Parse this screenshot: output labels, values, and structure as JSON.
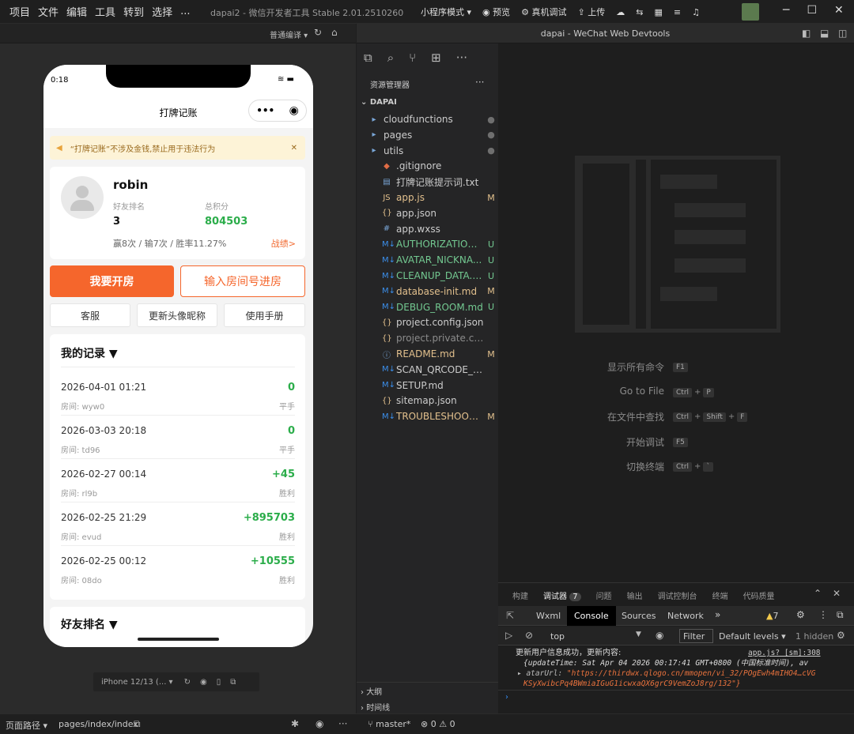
{
  "menu": [
    "项目",
    "文件",
    "编辑",
    "工具",
    "转到",
    "选择",
    "..."
  ],
  "app_title": "dapai2 - 微信开发者工具 Stable 2.01.2510260",
  "top_actions": {
    "mode": "小程序模式",
    "preview": "预览",
    "real": "真机调试",
    "upload": "上传"
  },
  "sim_toolbar": {
    "compile": "普通编译"
  },
  "window_title": "dapai - WeChat Web Devtools",
  "phone": {
    "time": "0:18",
    "page_title": "打牌记账",
    "notice": "“打牌记账”不涉及金钱,禁止用于违法行为",
    "user": {
      "name": "robin",
      "rank_label": "好友排名",
      "rank": "3",
      "score_label": "总积分",
      "score": "804503",
      "stats": "赢8次 / 输7次 / 胜率11.27%",
      "record_link": "战绩>"
    },
    "btn_open": "我要开房",
    "btn_join": "输入房间号进房",
    "btn_service": "客服",
    "btn_update": "更新头像昵称",
    "btn_manual": "使用手册",
    "records_title": "我的记录 ▼",
    "records": [
      {
        "date": "2026-04-01 01:21",
        "room": "房间: wyw0",
        "value": "0",
        "status": "平手"
      },
      {
        "date": "2026-03-03 20:18",
        "room": "房间: td96",
        "value": "0",
        "status": "平手"
      },
      {
        "date": "2026-02-27 00:14",
        "room": "房间: rl9b",
        "value": "+45",
        "status": "胜利"
      },
      {
        "date": "2026-02-25 21:29",
        "room": "房间: evud",
        "value": "+895703",
        "status": "胜利"
      },
      {
        "date": "2026-02-25 00:12",
        "room": "房间: 08do",
        "value": "+10555",
        "status": "胜利"
      }
    ],
    "friends_title": "好友排名 ▼"
  },
  "device": "iPhone 12/13 (...",
  "explorer": {
    "title": "资源管理器",
    "root": "DAPAI",
    "items": [
      {
        "name": "cloudfunctions",
        "icon": "▸",
        "status": "●",
        "color": "#cccccc",
        "scolor": "#6f6f6f"
      },
      {
        "name": "pages",
        "icon": "▸",
        "status": "●",
        "color": "#cccccc",
        "scolor": "#6f6f6f"
      },
      {
        "name": "utils",
        "icon": "▸",
        "status": "●",
        "color": "#cccccc",
        "scolor": "#6f6f6f"
      },
      {
        "name": ".gitignore",
        "icon": "◆",
        "status": "",
        "color": "#cccccc",
        "scolor": "#cccccc"
      },
      {
        "name": "打牌记账提示词.txt",
        "icon": "▤",
        "status": "",
        "color": "#cccccc",
        "scolor": "#cccccc"
      },
      {
        "name": "app.js",
        "icon": "JS",
        "status": "M",
        "color": "#e2c08d",
        "scolor": "#e2c08d"
      },
      {
        "name": "app.json",
        "icon": "{}",
        "status": "",
        "color": "#cccccc",
        "scolor": "#cccccc"
      },
      {
        "name": "app.wxss",
        "icon": "#",
        "status": "",
        "color": "#cccccc",
        "scolor": "#cccccc"
      },
      {
        "name": "AUTHORIZATION_...",
        "icon": "M↓",
        "status": "U",
        "color": "#73c991",
        "scolor": "#73c991"
      },
      {
        "name": "AVATAR_NICKNA...",
        "icon": "M↓",
        "status": "U",
        "color": "#73c991",
        "scolor": "#73c991"
      },
      {
        "name": "CLEANUP_DATA.md",
        "icon": "M↓",
        "status": "U",
        "color": "#73c991",
        "scolor": "#73c991"
      },
      {
        "name": "database-init.md",
        "icon": "M↓",
        "status": "M",
        "color": "#e2c08d",
        "scolor": "#e2c08d"
      },
      {
        "name": "DEBUG_ROOM.md",
        "icon": "M↓",
        "status": "U",
        "color": "#73c991",
        "scolor": "#73c991"
      },
      {
        "name": "project.config.json",
        "icon": "{}",
        "status": "",
        "color": "#cccccc",
        "scolor": "#cccccc"
      },
      {
        "name": "project.private.config.js...",
        "icon": "{}",
        "status": "",
        "color": "#8c8c8c",
        "scolor": "#8c8c8c"
      },
      {
        "name": "README.md",
        "icon": "ⓘ",
        "status": "M",
        "color": "#e2c08d",
        "scolor": "#e2c08d"
      },
      {
        "name": "SCAN_QRCODE_GUIDE...",
        "icon": "M↓",
        "status": "",
        "color": "#cccccc",
        "scolor": "#cccccc"
      },
      {
        "name": "SETUP.md",
        "icon": "M↓",
        "status": "",
        "color": "#cccccc",
        "scolor": "#cccccc"
      },
      {
        "name": "sitemap.json",
        "icon": "{}",
        "status": "",
        "color": "#cccccc",
        "scolor": "#cccccc"
      },
      {
        "name": "TROUBLESHOOTI...",
        "icon": "M↓",
        "status": "M",
        "color": "#e2c08d",
        "scolor": "#e2c08d"
      }
    ],
    "outline": "大纲",
    "timeline": "时间线"
  },
  "hints": [
    {
      "label": "显示所有命令",
      "keys": [
        "F1"
      ]
    },
    {
      "label": "Go to File",
      "keys": [
        "Ctrl",
        "+",
        "P"
      ]
    },
    {
      "label": "在文件中查找",
      "keys": [
        "Ctrl",
        "+",
        "Shift",
        "+",
        "F"
      ]
    },
    {
      "label": "开始调试",
      "keys": [
        "F5"
      ]
    },
    {
      "label": "切换终端",
      "keys": [
        "Ctrl",
        "+",
        "`"
      ]
    }
  ],
  "panel_tabs": [
    "构建",
    "调试器",
    "问题",
    "输出",
    "调试控制台",
    "终端",
    "代码质量"
  ],
  "debugger_count": "7",
  "dev_tabs": [
    "Wxml",
    "Console",
    "Sources",
    "Network"
  ],
  "warn_count": "7",
  "console": {
    "context": "top",
    "filter": "Filter",
    "levels": "Default levels",
    "hidden": "1 hidden",
    "line1": "更新用户信息成功，更新内容:",
    "src": "app.js? [sm]:308",
    "line2": "{updateTime: Sat Apr 04 2026 00:17:41 GMT+0800 (中国标准时间), av",
    "line3_key": "▸ atarUrl: ",
    "line3_val": "\"https://thirdwx.qlogo.cn/mmopen/vi_32/POgEwh4mIHO4…cVG",
    "line4": "KSyXwibcPq4BWmiaIGuG1icwxaQX6grC9VemZoJ8rg/132\"}"
  },
  "status": {
    "path_label": "页面路径",
    "path": "pages/index/index",
    "branch": "master*",
    "errors": "⊗ 0 ⚠ 0"
  }
}
